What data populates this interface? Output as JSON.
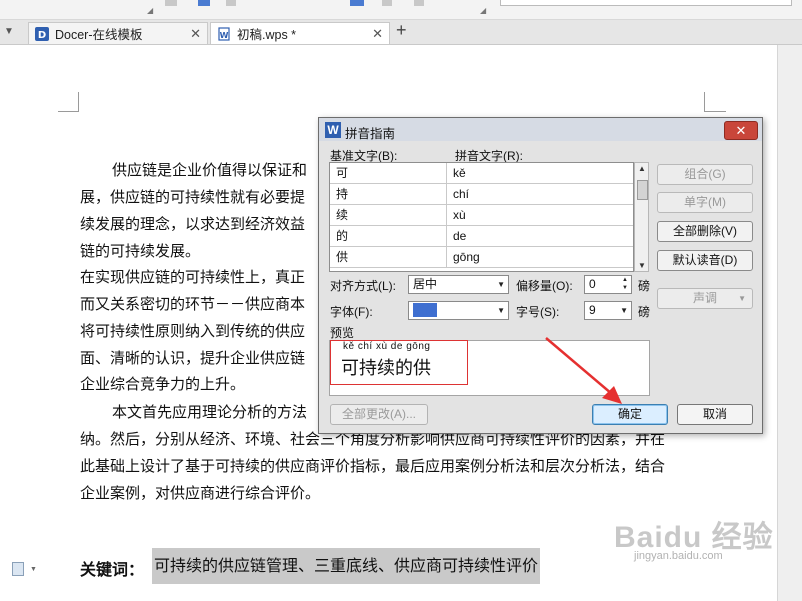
{
  "tabs": [
    {
      "label": "Docer-在线模板",
      "icon": "docer-icon"
    },
    {
      "label": "初稿.wps *",
      "icon": "document-icon"
    }
  ],
  "document": {
    "lines": [
      "供应链是企业价值得以保证和",
      "展，供应链的可持续性就有必要提",
      "续发展的理念，以求达到经济效益",
      "链的可持续发展。",
      "在实现供应链的可持续性上，真正",
      "而又关系密切的环节－－供应商本",
      "将可持续性原则纳入到传统的供应",
      "面、清晰的认识，提升企业供应链",
      "企业综合竞争力的上升。",
      "本文首先应用理论分析的方法",
      "纳。然后，分别从经济、环境、社会三个角度分析影响供应商可持续性评价的因素，并在",
      "此基础上设计了基于可持续的供应商评价指标，最后应用案例分析法和层次分析法，结合",
      "企业案例，对供应商进行综合评价。"
    ],
    "keywords_label": "关键词：",
    "keywords": "可持续的供应链管理、三重底线、供应商可持续性评价"
  },
  "watermark": {
    "text": "Baidu 经验",
    "sub": "jingyan.baidu.com"
  },
  "dialog": {
    "title": "拼音指南",
    "close": "✕",
    "base_label": "基准文字(B):",
    "ruby_label": "拼音文字(R):",
    "rows": [
      {
        "base": "可",
        "ruby": "kě"
      },
      {
        "base": "持",
        "ruby": "chí"
      },
      {
        "base": "续",
        "ruby": "xù"
      },
      {
        "base": "的",
        "ruby": "de"
      },
      {
        "base": "供",
        "ruby": "gōng"
      }
    ],
    "buttons": {
      "group": "组合(G)",
      "single": "单字(M)",
      "clear_all": "全部删除(V)",
      "default_reading": "默认读音(D)",
      "tone": "声调",
      "apply_all": "全部更改(A)...",
      "ok": "确定",
      "cancel": "取消"
    },
    "align_label": "对齐方式(L):",
    "align_value": "居中",
    "offset_label": "偏移量(O):",
    "offset_value": "0",
    "offset_unit": "磅",
    "font_label": "字体(F):",
    "font_value": "黑体",
    "size_label": "字号(S):",
    "size_value": "9",
    "size_unit": "磅",
    "preview_label": "预览",
    "preview_ruby": "kě chí xù de gōng",
    "preview_text": "可持续的供"
  },
  "colors": {
    "accent": "#3c7fb1",
    "close_red": "#c9463a",
    "annotation_red": "#e53030",
    "keyword_highlight": "#c9c9c9"
  }
}
